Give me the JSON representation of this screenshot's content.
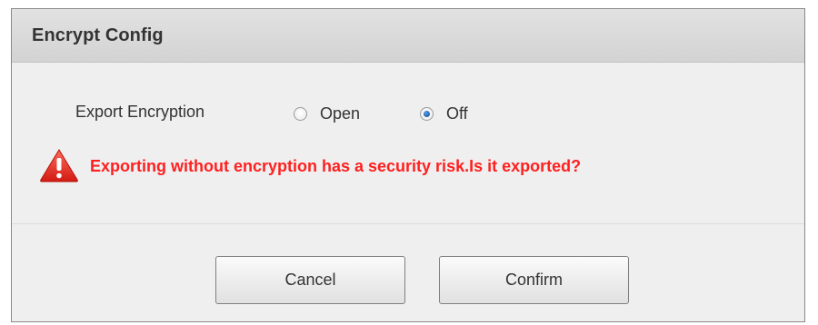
{
  "dialog": {
    "title": "Encrypt Config"
  },
  "export_encryption": {
    "label": "Export Encryption",
    "options": [
      {
        "label": "Open",
        "selected": false
      },
      {
        "label": "Off",
        "selected": true
      }
    ]
  },
  "warning": {
    "icon": "warning-triangle-icon",
    "text": "Exporting without encryption has a security risk.Is it exported?",
    "color": "#ff2020"
  },
  "buttons": {
    "cancel_label": "Cancel",
    "confirm_label": "Confirm"
  }
}
